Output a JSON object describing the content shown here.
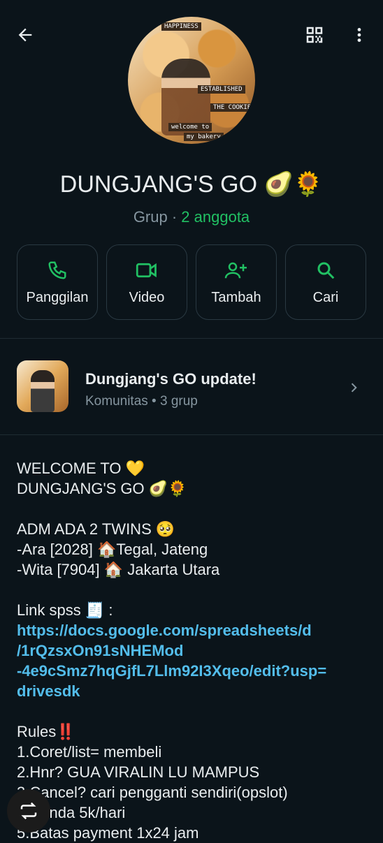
{
  "group": {
    "title": "DUNGJANG'S GO 🥑🌻",
    "type_label": "Grup",
    "separator": " · ",
    "member_count": "2 anggota"
  },
  "avatar_stickers": [
    "HAPPINESS",
    "ESTABLISHED",
    "welcome to",
    "my bakery",
    "THE COOKIE"
  ],
  "actions": [
    {
      "label": "Panggilan",
      "icon": "phone-icon"
    },
    {
      "label": "Video",
      "icon": "video-icon"
    },
    {
      "label": "Tambah",
      "icon": "add-person-icon"
    },
    {
      "label": "Cari",
      "icon": "search-icon"
    }
  ],
  "community": {
    "title": "Dungjang's GO update!",
    "subtitle": "Komunitas • 3 grup"
  },
  "description": {
    "lines": [
      "WELCOME TO 💛",
      "DUNGJANG'S GO 🥑🌻",
      "",
      "ADM ADA 2 TWINS 🥺",
      "-Ara [2028] 🏠Tegal, Jateng",
      "-Wita [7904] 🏠 Jakarta Utara",
      "",
      "Link spss 🧾 :"
    ],
    "link_lines": [
      "https://docs.google.com/spreadsheets/d",
      "/1rQzsxOn91sNHEMod",
      "-4e9cSmz7hqGjfL7Llm92I3Xqeo/edit?usp=",
      "drivesdk"
    ],
    "rules_lines": [
      "",
      "Rules‼️",
      "1.Coret/list= membeli",
      "2.Hnr? GUA VIRALIN LU MAMPUS",
      "3.Cancel? cari pengganti sendiri(opslot)",
      "4.Denda 5k/hari",
      "5.Batas payment 1x24 jam"
    ]
  },
  "colors": {
    "background": "#0b141a",
    "accent_green": "#21c063",
    "link": "#53bdeb",
    "muted": "#8696a0"
  }
}
